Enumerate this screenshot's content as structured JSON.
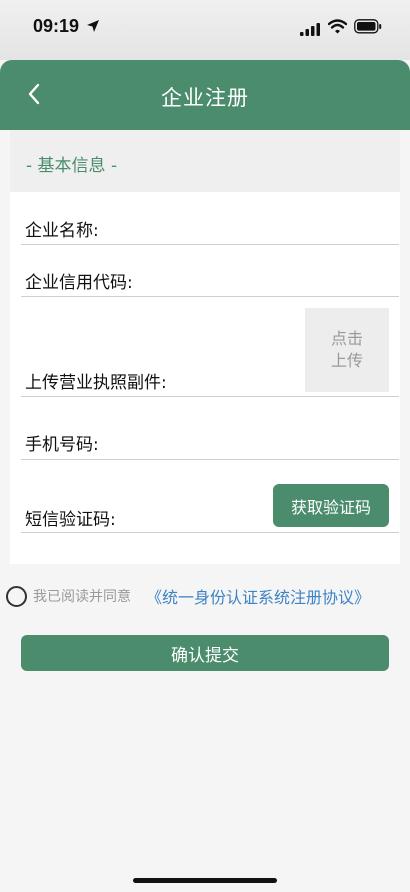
{
  "status_bar": {
    "time": "09:19"
  },
  "nav": {
    "title": "企业注册"
  },
  "section": {
    "title": "- 基本信息 -"
  },
  "form": {
    "company_name_label": "企业名称:",
    "credit_code_label": "企业信用代码:",
    "license_label": "上传营业执照副件:",
    "upload_line1": "点击",
    "upload_line2": "上传",
    "phone_label": "手机号码:",
    "sms_code_label": "短信验证码:",
    "get_code_button": "获取验证码"
  },
  "agreement": {
    "prefix": "我已阅读并同意",
    "link": "《统一身份认证系统注册协议》"
  },
  "submit_label": "确认提交",
  "colors": {
    "primary_green": "#4a8c6c",
    "link_blue": "#3d83c4"
  }
}
